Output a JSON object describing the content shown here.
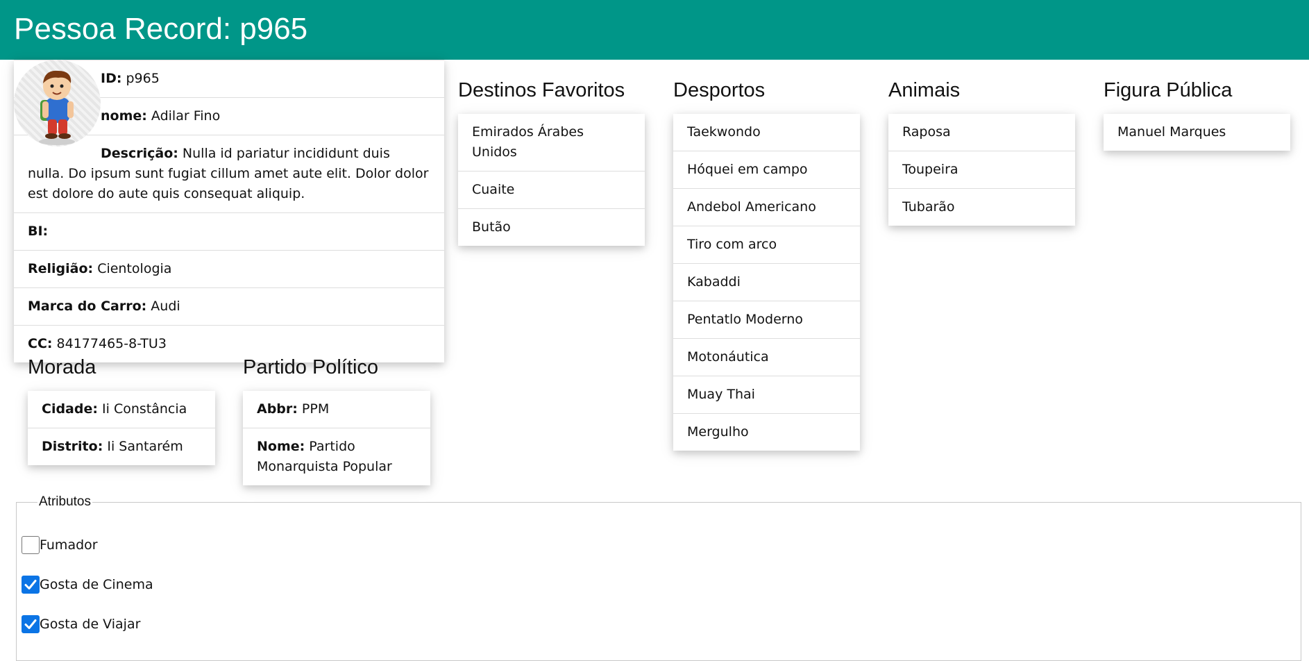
{
  "header": {
    "title": "Pessoa Record: p965"
  },
  "person": {
    "id_label": "ID:",
    "id_value": "p965",
    "nome_label": "nome:",
    "nome_value": "Adilar Fino",
    "descricao_label": "Descrição:",
    "descricao_value": "Nulla id pariatur incididunt duis nulla. Do ipsum sunt fugiat cillum amet aute elit. Dolor dolor est dolore do aute quis consequat aliquip.",
    "bi_label": "BI:",
    "bi_value": "",
    "religiao_label": "Religião:",
    "religiao_value": "Cientologia",
    "carro_label": "Marca do Carro:",
    "carro_value": "Audi",
    "cc_label": "CC:",
    "cc_value": "84177465-8-TU3"
  },
  "destinos": {
    "title": "Destinos Favoritos",
    "items": [
      "Emirados Árabes Unidos",
      "Cuaite",
      "Butão"
    ]
  },
  "desportos": {
    "title": "Desportos",
    "items": [
      "Taekwondo",
      "Hóquei em campo",
      "Andebol Americano",
      "Tiro com arco",
      "Kabaddi",
      "Pentatlo Moderno",
      "Motonáutica",
      "Muay Thai",
      "Mergulho"
    ]
  },
  "animais": {
    "title": "Animais",
    "items": [
      "Raposa",
      "Toupeira",
      "Tubarão"
    ]
  },
  "figura": {
    "title": "Figura Pública",
    "items": [
      "Manuel Marques"
    ]
  },
  "morada": {
    "title": "Morada",
    "cidade_label": "Cidade:",
    "cidade_value": "Ii Constância",
    "distrito_label": "Distrito:",
    "distrito_value": "Ii Santarém"
  },
  "partido": {
    "title": "Partido Político",
    "abbr_label": "Abbr:",
    "abbr_value": "PPM",
    "nome_label": "Nome:",
    "nome_value": "Partido Monarquista Popular"
  },
  "atributos": {
    "legend": "Atributos",
    "items": [
      {
        "label": "Fumador",
        "checked": false
      },
      {
        "label": "Gosta de Cinema",
        "checked": true
      },
      {
        "label": "Gosta de Viajar",
        "checked": true
      }
    ]
  },
  "colors": {
    "header": "#009688",
    "checkbox": "#0b74e5"
  }
}
